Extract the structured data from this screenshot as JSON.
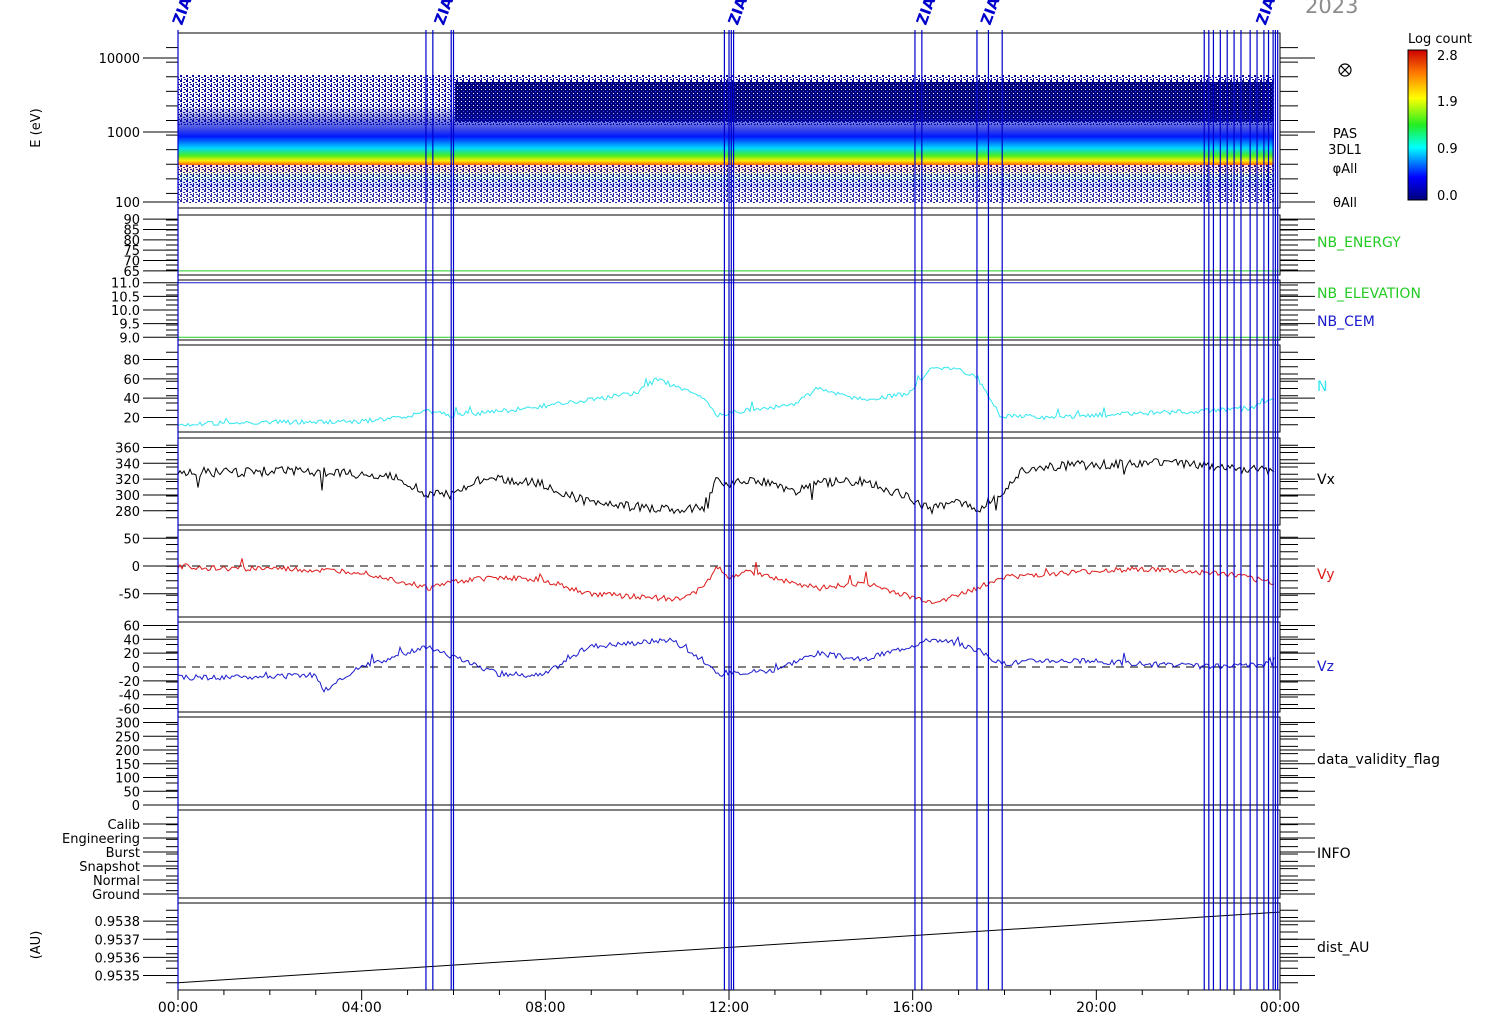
{
  "year_label": "2023",
  "colorbar": {
    "title": "Log count",
    "ticks": [
      "2.8",
      "1.9",
      "0.9",
      "0.0"
    ]
  },
  "colors": {
    "frame": "#000000",
    "event_lines": "#0000cc",
    "spectrogram_bg": "#00007a",
    "N": "#33e6f0",
    "Vx": "#000000",
    "Vy": "#dd1a1a",
    "Vz": "#1a1acc",
    "NB_ENERGY": "#22cc22",
    "NB_ELEVATION": "#22cc22",
    "NB_CEM": "#1a1acc"
  },
  "top_markers": [
    "ZIAS",
    "ZIAS",
    "ZIAS",
    "ZIAS",
    "ZIAS",
    "ZIAS"
  ],
  "chart_data": [
    {
      "type": "heatmap",
      "panel": "spectrogram",
      "ylabel": "E (eV)",
      "yscale": "log",
      "ylim": [
        100,
        15000
      ],
      "yticks": [
        "10000",
        "1000",
        "100"
      ],
      "right_labels": [
        "PAS",
        "3DL1",
        "φAll",
        "θAll"
      ],
      "legend_icon": "circle-cross-icon",
      "peak_energy_eV": 600,
      "colorbar_range": [
        0.0,
        2.8
      ]
    },
    {
      "type": "line",
      "panel": "nb_energy",
      "label": "NB_ENERGY",
      "yticks": [
        "90",
        "85",
        "80",
        "75",
        "70",
        "65"
      ],
      "ylim": [
        63,
        92
      ],
      "constant_value": 65
    },
    {
      "type": "line",
      "panel": "nb_elevation",
      "labels": [
        "NB_ELEVATION",
        "NB_CEM"
      ],
      "yticks": [
        "11.0",
        "10.5",
        "10.0",
        "9.5",
        "9.0"
      ],
      "ylim": [
        8.9,
        11.1
      ],
      "NB_ELEVATION": 9.0,
      "NB_CEM": 11.0
    },
    {
      "type": "line",
      "panel": "density",
      "label": "N",
      "yticks": [
        "80",
        "60",
        "40",
        "20"
      ],
      "ylim": [
        5,
        95
      ],
      "x": [
        0,
        1,
        2,
        3,
        4,
        5,
        5.5,
        6,
        7,
        8,
        9,
        10,
        10.5,
        11,
        11.5,
        11.8,
        12,
        12.5,
        13,
        13.5,
        14,
        15,
        16,
        16.5,
        17,
        17.5,
        18,
        19,
        20,
        21,
        22,
        23,
        23.5,
        24
      ],
      "values": [
        13,
        14,
        15,
        15,
        16,
        20,
        27,
        22,
        26,
        32,
        38,
        45,
        60,
        50,
        40,
        22,
        24,
        28,
        30,
        34,
        50,
        38,
        45,
        70,
        72,
        60,
        22,
        20,
        22,
        24,
        26,
        28,
        30,
        38
      ]
    },
    {
      "type": "line",
      "panel": "vx",
      "label": "Vx",
      "yticks": [
        "360",
        "340",
        "320",
        "300",
        "280"
      ],
      "ylim": [
        262,
        372
      ],
      "x": [
        0,
        1,
        2,
        3,
        4,
        4.8,
        5.5,
        6,
        6.5,
        7,
        8,
        9,
        10,
        11,
        11.5,
        11.8,
        12,
        12.5,
        13,
        13.5,
        14,
        15,
        16,
        16.5,
        17,
        17.5,
        18,
        18.5,
        19,
        20,
        21,
        22,
        23,
        24
      ],
      "values": [
        330,
        328,
        330,
        330,
        325,
        322,
        300,
        300,
        318,
        320,
        314,
        290,
        285,
        280,
        285,
        320,
        312,
        318,
        315,
        305,
        315,
        318,
        298,
        280,
        295,
        282,
        300,
        330,
        336,
        338,
        340,
        340,
        334,
        330
      ]
    },
    {
      "type": "line",
      "panel": "vy",
      "label": "Vy",
      "yticks": [
        "50",
        "0",
        "-50"
      ],
      "ylim": [
        -92,
        65
      ],
      "dashed_zero": true,
      "x": [
        0,
        1,
        2,
        3,
        4,
        5,
        5.5,
        6,
        7,
        8,
        9,
        10,
        11,
        11.5,
        11.8,
        12,
        12.5,
        13,
        13.5,
        14,
        15,
        16,
        16.5,
        17,
        17.5,
        18,
        19,
        20,
        21,
        22,
        23,
        24
      ],
      "values": [
        0,
        -5,
        -4,
        -8,
        -10,
        -30,
        -40,
        -28,
        -20,
        -25,
        -50,
        -55,
        -60,
        -40,
        0,
        -20,
        -10,
        -20,
        -30,
        -40,
        -30,
        -55,
        -65,
        -55,
        -40,
        -20,
        -15,
        -10,
        -5,
        -10,
        -15,
        -30
      ]
    },
    {
      "type": "line",
      "panel": "vz",
      "label": "Vz",
      "yticks": [
        "60",
        "40",
        "20",
        "0",
        "-20",
        "-40",
        "-60"
      ],
      "ylim": [
        -65,
        65
      ],
      "dashed_zero": true,
      "x": [
        0,
        1,
        2,
        3,
        3.2,
        4,
        5,
        5.5,
        6,
        7,
        8,
        9,
        10,
        10.8,
        11.5,
        11.8,
        12,
        13,
        14,
        15,
        16,
        16.5,
        17,
        17.5,
        18,
        19,
        20,
        21,
        22,
        23,
        24
      ],
      "values": [
        -15,
        -15,
        -14,
        -12,
        -35,
        0,
        20,
        30,
        15,
        -10,
        -12,
        30,
        35,
        40,
        10,
        -12,
        -8,
        -5,
        20,
        10,
        30,
        40,
        35,
        25,
        5,
        10,
        8,
        5,
        2,
        0,
        5
      ]
    },
    {
      "type": "line",
      "panel": "data_validity",
      "label": "data_validity_flag",
      "yticks": [
        "300",
        "250",
        "200",
        "150",
        "100",
        "50",
        "0"
      ],
      "ylim": [
        0,
        320
      ]
    },
    {
      "type": "table",
      "panel": "info",
      "label": "INFO",
      "categories": [
        "Calib",
        "Engineering",
        "Burst",
        "Snapshot",
        "Normal",
        "Ground"
      ]
    },
    {
      "type": "line",
      "panel": "distance",
      "label": "dist_AU",
      "ylabel": "(AU)",
      "yticks": [
        "0.9538",
        "0.9537",
        "0.9536",
        "0.9535"
      ],
      "ylim": [
        0.95342,
        0.9539
      ],
      "x": [
        0,
        24
      ],
      "values": [
        0.95346,
        0.95385
      ]
    }
  ],
  "x_axis": {
    "ticks": [
      "00:00",
      "04:00",
      "08:00",
      "12:00",
      "16:00",
      "20:00",
      "00:00"
    ],
    "range_hours": [
      0,
      24
    ]
  },
  "event_markers_hours": [
    0.0,
    5.4,
    5.55,
    5.95,
    6.0,
    11.9,
    12.0,
    12.05,
    12.1,
    16.05,
    16.2,
    17.4,
    17.65,
    17.95,
    22.35,
    22.45,
    22.55,
    22.7,
    22.85,
    23.0,
    23.15,
    23.35,
    23.5,
    23.65,
    23.75,
    23.85,
    23.9,
    23.95
  ]
}
